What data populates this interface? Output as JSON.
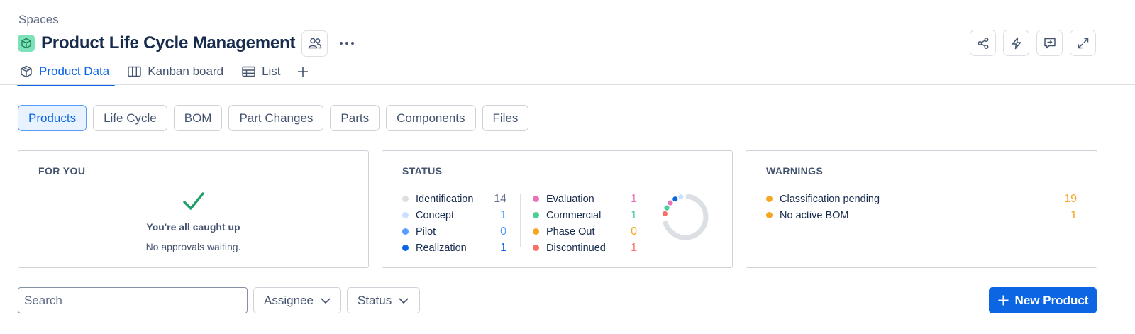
{
  "breadcrumb": "Spaces",
  "title": "Product Life Cycle Management",
  "tabs": [
    {
      "label": "Product Data",
      "icon": "cube-icon",
      "active": true
    },
    {
      "label": "Kanban board",
      "icon": "board-icon",
      "active": false
    },
    {
      "label": "List",
      "icon": "table-icon",
      "active": false
    }
  ],
  "subtabs": [
    "Products",
    "Life Cycle",
    "BOM",
    "Part Changes",
    "Parts",
    "Components",
    "Files"
  ],
  "for_you": {
    "title": "FOR YOU",
    "headline": "You're all caught up",
    "sub": "No approvals waiting."
  },
  "status": {
    "title": "STATUS",
    "items": [
      {
        "label": "Identification",
        "count": "14",
        "color": "#dcdfe4",
        "count_color": "#626f86"
      },
      {
        "label": "Concept",
        "count": "1",
        "color": "#cce0ff",
        "count_color": "#579dff"
      },
      {
        "label": "Pilot",
        "count": "0",
        "color": "#579dff",
        "count_color": "#579dff"
      },
      {
        "label": "Realization",
        "count": "1",
        "color": "#0c66e4",
        "count_color": "#0c66e4"
      },
      {
        "label": "Evaluation",
        "count": "1",
        "color": "#e774bb",
        "count_color": "#e774bb"
      },
      {
        "label": "Commercial",
        "count": "1",
        "color": "#4bce97",
        "count_color": "#4bce97"
      },
      {
        "label": "Phase Out",
        "count": "0",
        "color": "#f5a623",
        "count_color": "#f5a623"
      },
      {
        "label": "Discontinued",
        "count": "1",
        "color": "#f87168",
        "count_color": "#f87168"
      }
    ]
  },
  "warnings": {
    "title": "WARNINGS",
    "items": [
      {
        "label": "Classification pending",
        "count": "19",
        "color": "#f5a623"
      },
      {
        "label": "No active BOM",
        "count": "1",
        "color": "#f5a623"
      }
    ]
  },
  "toolbar": {
    "search_placeholder": "Search",
    "assignee_label": "Assignee",
    "status_label": "Status",
    "new_button": "New Product"
  },
  "icons": {
    "space": "cube-icon",
    "people": "people-icon",
    "more": "more-icon",
    "actions": [
      "share-icon",
      "lightning-icon",
      "feedback-icon",
      "expand-icon"
    ]
  },
  "colors": {
    "accent": "#0c66e4",
    "success": "#22a06b",
    "warning": "#f5a623"
  }
}
